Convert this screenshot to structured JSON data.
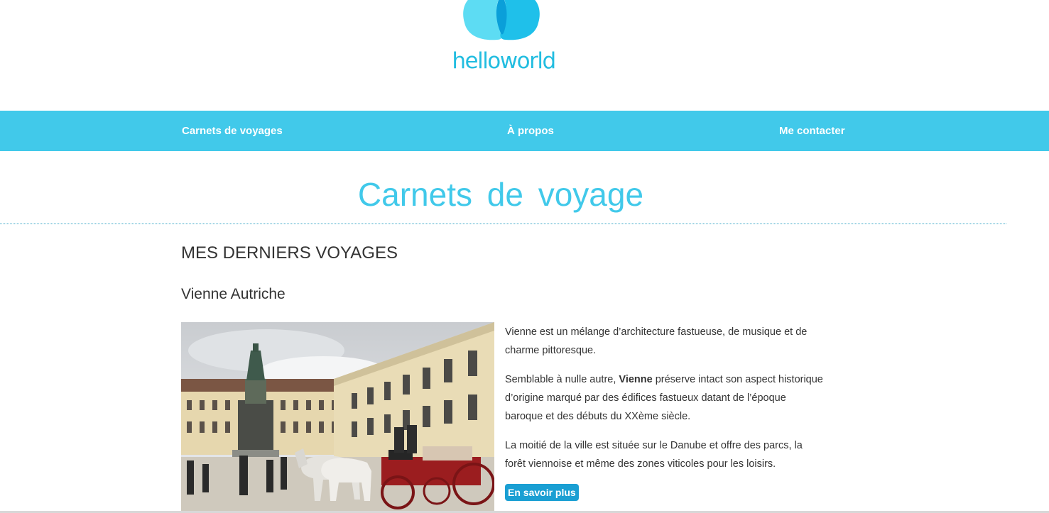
{
  "brand": {
    "name": "helloworld",
    "colors": {
      "primary": "#41c9ea",
      "logo_light": "#5ddcf3",
      "logo_dark": "#0a9fd9",
      "button": "#1a9fd3"
    }
  },
  "nav": {
    "items": [
      {
        "label": "Carnets de voyages"
      },
      {
        "label": "À propos"
      },
      {
        "label": "Me contacter"
      }
    ]
  },
  "page": {
    "title": "Carnets de voyage"
  },
  "section": {
    "heading": "MES DERNIERS VOYAGES"
  },
  "trip": {
    "title": "Vienne Autriche",
    "photo_icon": "vienna-photo",
    "p1": "Vienne est un mélange d’architecture fastueuse, de musique et de charme pittoresque.",
    "p2_start": "Semblable à nulle autre, ",
    "p2_bold": "Vienne",
    "p2_end": " préserve intact son aspect historique d’origine marqué par des édifices fastueux datant de l’époque baroque et des débuts du XXème siècle.",
    "p3": "La moitié de la ville est située sur le Danube et offre des parcs, la forêt viennoise et même des zones viticoles pour les loisirs.",
    "button_label": "En savoir plus"
  }
}
